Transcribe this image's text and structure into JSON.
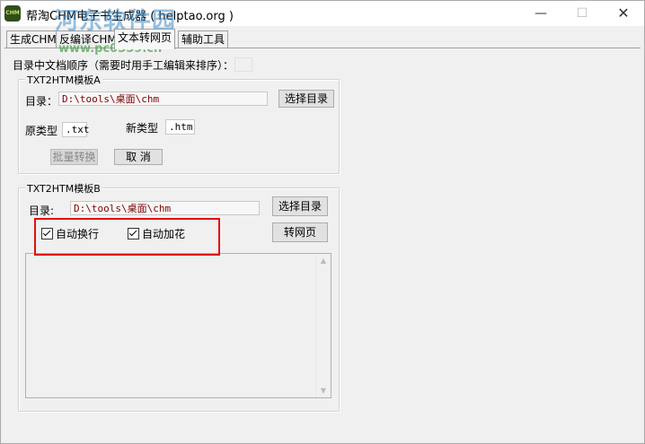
{
  "window": {
    "title": "帮淘CHM电子书生成器 ( helptao.org )",
    "icon_text": "CHM",
    "watermark_main": "河东软件园",
    "watermark_url": "www.pc0359.cn",
    "controls": {
      "minimize": "—",
      "maximize": "☐",
      "close": "✕"
    }
  },
  "tabs": [
    {
      "label": "生成CHM"
    },
    {
      "label": "反编译CHM"
    },
    {
      "label": "文本转网页"
    },
    {
      "label": "辅助工具"
    }
  ],
  "panel": {
    "order_label": "目录中文档顺序（需要时用手工编辑来排序）：",
    "group_a": {
      "title": "TXT2HTM模板A",
      "dir_label": "目录：",
      "dir_value": "D:\\tools\\桌面\\chm",
      "select_dir": "选择目录",
      "orig_type_label": "原类型",
      "orig_type_value": ".txt",
      "new_type_label": "新类型",
      "new_type_value": ".htm",
      "batch_convert": "批量转换",
      "cancel": "取 消"
    },
    "group_b": {
      "title": "TXT2HTM模板B",
      "dir_label": "目录:",
      "dir_value": "D:\\tools\\桌面\\chm",
      "select_dir": "选择目录",
      "auto_wrap": "自动换行",
      "auto_wrap_checked": true,
      "auto_decorate": "自动加花",
      "auto_decorate_checked": true,
      "to_webpage": "转网页",
      "scroll_up": "▲",
      "scroll_down": "▼"
    }
  },
  "colors": {
    "highlight": "#e01010",
    "path_text": "#800000"
  }
}
